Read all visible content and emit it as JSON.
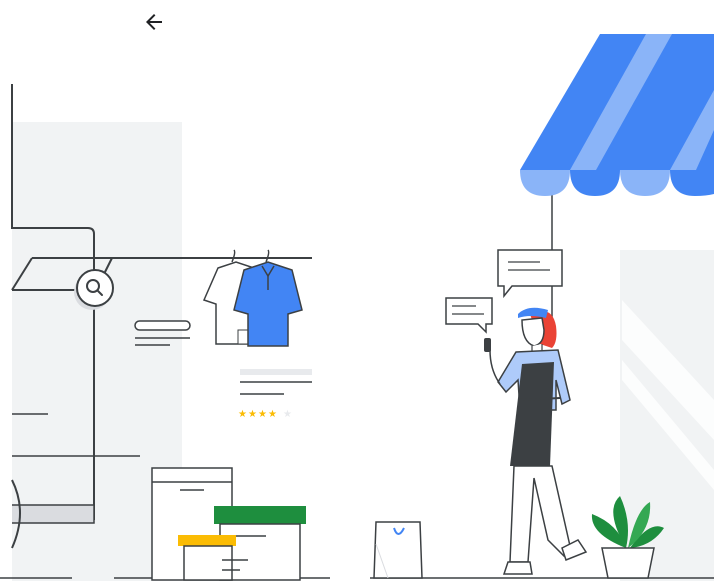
{
  "header": {
    "back_icon": "arrow-left-icon"
  },
  "illustration": {
    "subject": "storefront",
    "product_rating_stars": 4,
    "product_rating_max": 5,
    "colors": {
      "awning_blue": "#4285f4",
      "awning_light": "#8ab4f8",
      "shirt_blue": "#4285f4",
      "rating_star": "#fbbc04",
      "box_green": "#1e8e3e",
      "box_yellow": "#fbbc04",
      "line": "#3c4043",
      "wall_gray": "#f1f3f4",
      "hair_red": "#ea4335",
      "apron": "#3c4043",
      "plant_green": "#1e8e3e"
    }
  }
}
